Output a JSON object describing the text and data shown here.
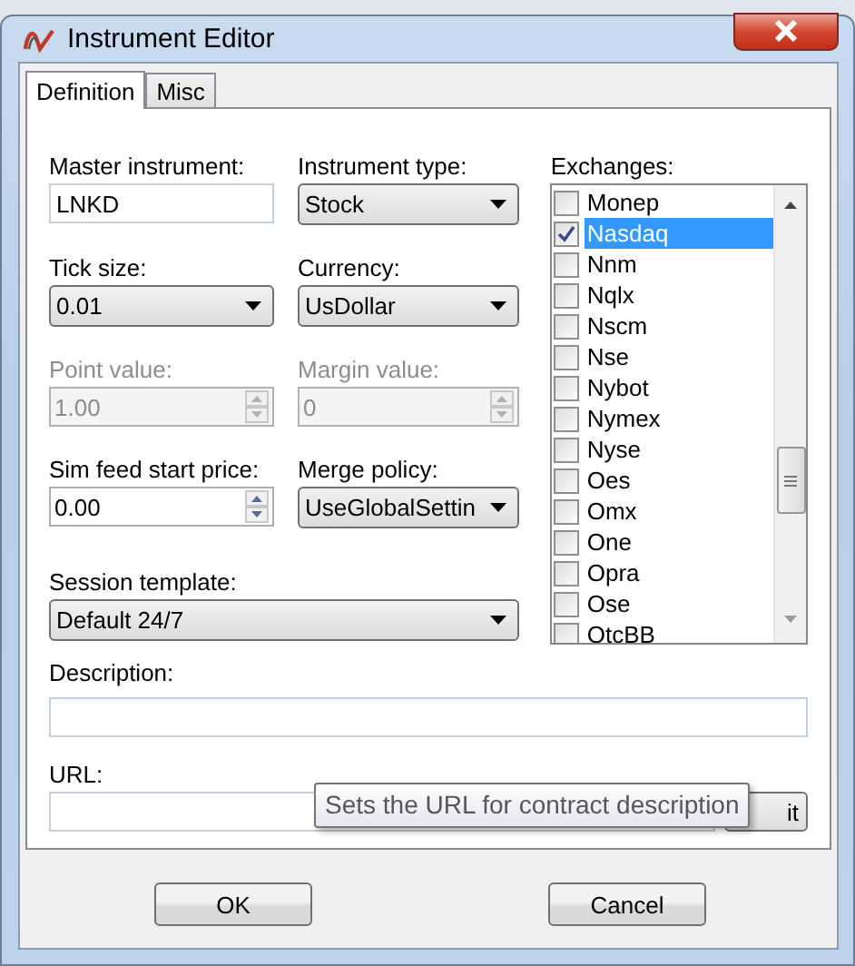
{
  "window": {
    "title": "Instrument Editor"
  },
  "tabs": [
    {
      "label": "Definition",
      "selected": true
    },
    {
      "label": "Misc",
      "selected": false
    }
  ],
  "fields": [
    {
      "kind": "text",
      "label": "Master instrument:",
      "value": "LNKD",
      "disabled": false
    },
    {
      "kind": "combo",
      "label": "Instrument type:",
      "value": "Stock",
      "disabled": false
    },
    {
      "kind": "combo",
      "label": "Tick size:",
      "value": "0.01",
      "disabled": false
    },
    {
      "kind": "combo",
      "label": "Currency:",
      "value": "UsDollar",
      "disabled": false
    },
    {
      "kind": "spin",
      "label": "Point value:",
      "value": "1.00",
      "disabled": true
    },
    {
      "kind": "spin",
      "label": "Margin value:",
      "value": "0",
      "disabled": true
    },
    {
      "kind": "spin",
      "label": "Sim feed start price:",
      "value": "0.00",
      "disabled": false
    },
    {
      "kind": "combo",
      "label": "Merge policy:",
      "value": "UseGlobalSettin",
      "disabled": false
    }
  ],
  "session_template": {
    "label": "Session template:",
    "value": "Default 24/7"
  },
  "exchanges": {
    "label": "Exchanges:",
    "items": [
      {
        "name": "Monep",
        "checked": false,
        "selected": false
      },
      {
        "name": "Nasdaq",
        "checked": true,
        "selected": true
      },
      {
        "name": "Nnm",
        "checked": false,
        "selected": false
      },
      {
        "name": "Nqlx",
        "checked": false,
        "selected": false
      },
      {
        "name": "Nscm",
        "checked": false,
        "selected": false
      },
      {
        "name": "Nse",
        "checked": false,
        "selected": false
      },
      {
        "name": "Nybot",
        "checked": false,
        "selected": false
      },
      {
        "name": "Nymex",
        "checked": false,
        "selected": false
      },
      {
        "name": "Nyse",
        "checked": false,
        "selected": false
      },
      {
        "name": "Oes",
        "checked": false,
        "selected": false
      },
      {
        "name": "Omx",
        "checked": false,
        "selected": false
      },
      {
        "name": "One",
        "checked": false,
        "selected": false
      },
      {
        "name": "Opra",
        "checked": false,
        "selected": false
      },
      {
        "name": "Ose",
        "checked": false,
        "selected": false
      },
      {
        "name": "OtcBB",
        "checked": false,
        "selected": false
      }
    ]
  },
  "description": {
    "label": "Description:"
  },
  "url": {
    "label": "URL:",
    "button": "it",
    "tooltip": "Sets the URL for contract description"
  },
  "buttons": [
    "OK",
    "Cancel"
  ]
}
